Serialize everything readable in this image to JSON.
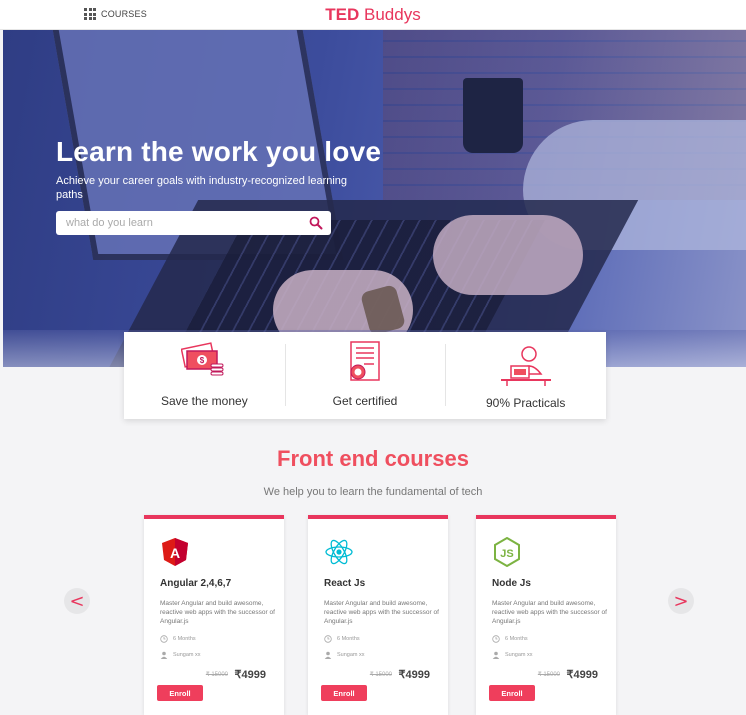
{
  "header": {
    "courses_label": "COURSES",
    "brand_bold": "TED",
    "brand_light": "Buddys"
  },
  "hero": {
    "title": "Learn the work you love",
    "subtitle": "Achieve your career goals with industry-recognized learning paths",
    "search_placeholder": "what do you learn",
    "search_value": ""
  },
  "features": [
    {
      "label": "Save the money",
      "icon": "money-icon"
    },
    {
      "label": "Get certified",
      "icon": "certificate-icon"
    },
    {
      "label": "90% Practicals",
      "icon": "practical-icon"
    }
  ],
  "section": {
    "title": "Front end courses",
    "subtitle": "We help you to learn the fundamental of tech"
  },
  "nav": {
    "prev": "<",
    "next": ">"
  },
  "courses": [
    {
      "name": "Angular 2,4,6,7",
      "description": "Master Angular and build awesome, reactive web apps with the successor of Angular.js",
      "duration": "6 Months",
      "author": "Sungam xx",
      "old_price": "₹ 15000",
      "price": "₹4999",
      "enroll": "Enroll",
      "icon": "angular-icon"
    },
    {
      "name": "React Js",
      "description": "Master Angular and build awesome, reactive web apps with the successor of Angular.js",
      "duration": "6 Months",
      "author": "Sungam xx",
      "old_price": "₹ 15000",
      "price": "₹4999",
      "enroll": "Enroll",
      "icon": "react-icon"
    },
    {
      "name": "Node Js",
      "description": "Master Angular and build awesome, reactive web apps with the successor of Angular.js",
      "duration": "6 Months",
      "author": "Sungam xx",
      "old_price": "₹ 15000",
      "price": "₹4999",
      "enroll": "Enroll",
      "icon": "nodejs-icon"
    }
  ],
  "colors": {
    "accent": "#e8365d",
    "button": "#ef3e5c",
    "hero_overlay": "#3c4c9c"
  }
}
